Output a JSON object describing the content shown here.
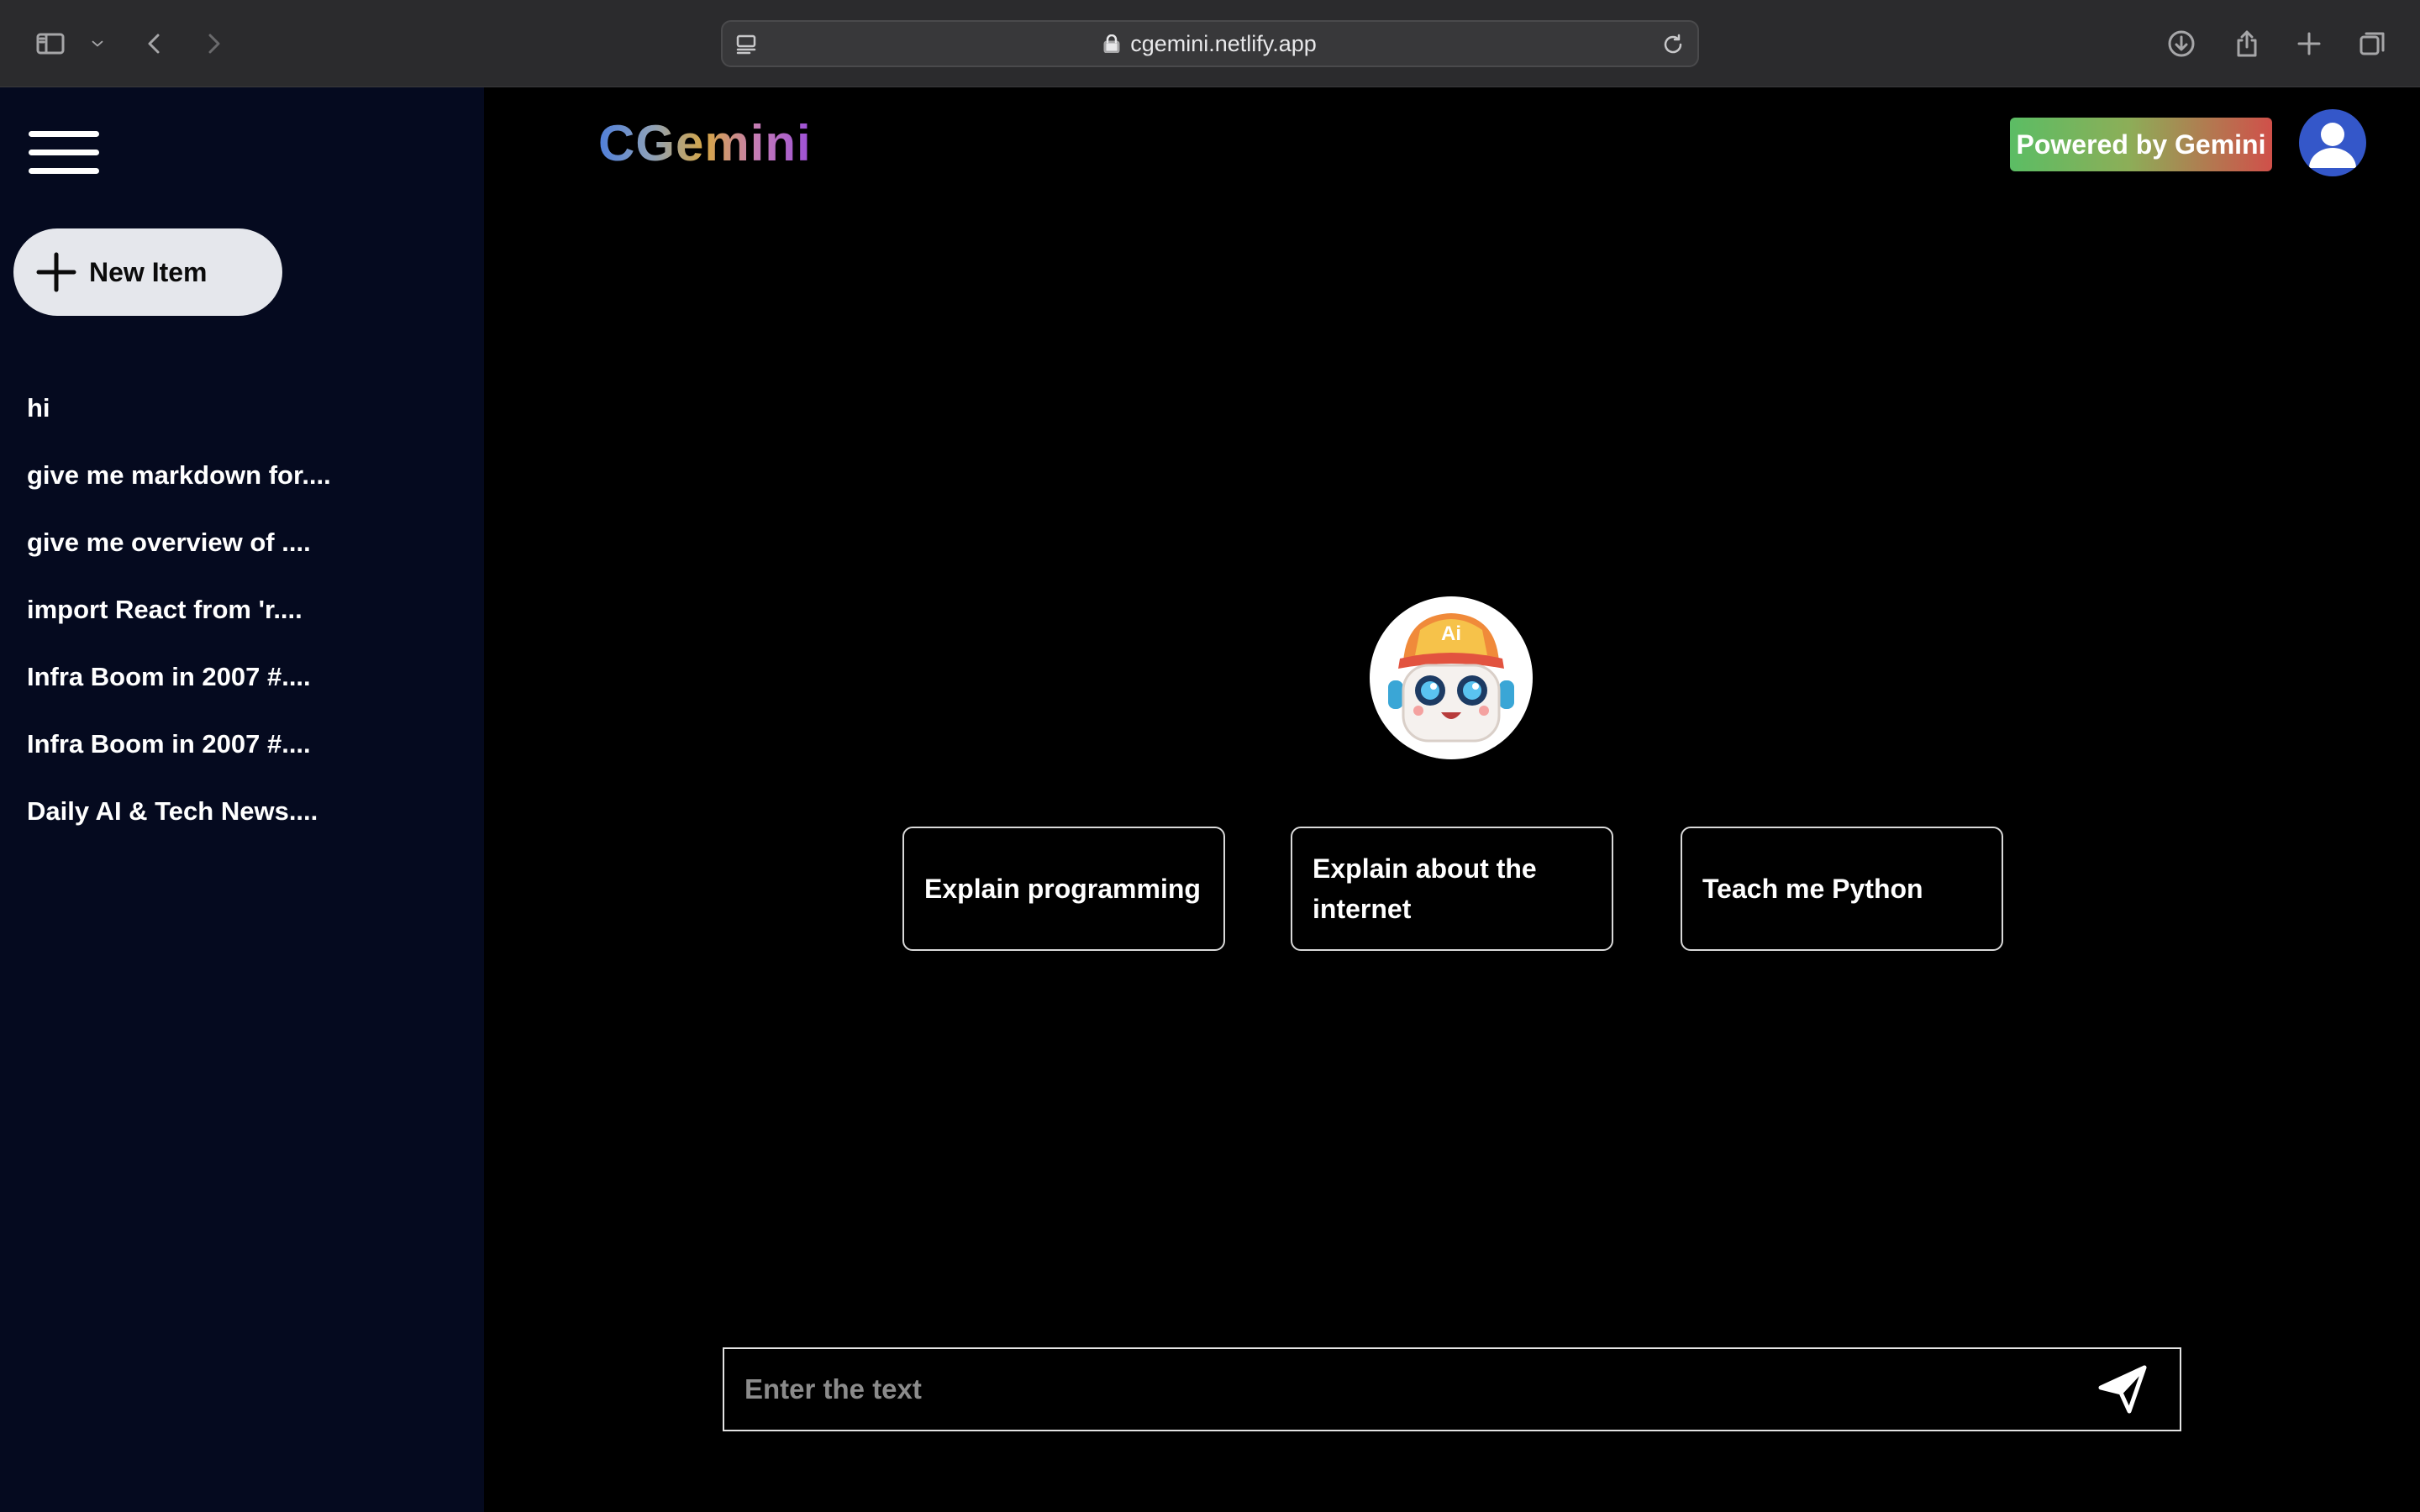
{
  "browser": {
    "url": "cgemini.netlify.app"
  },
  "sidebar": {
    "new_item_label": "New Item",
    "history": [
      {
        "label": "hi"
      },
      {
        "label": "give me markdown for...."
      },
      {
        "label": "give me overview of ...."
      },
      {
        "label": "import React from 'r...."
      },
      {
        "label": "Infra Boom in 2007 #...."
      },
      {
        "label": "Infra Boom in 2007 #...."
      },
      {
        "label": "Daily AI & Tech News...."
      }
    ]
  },
  "header": {
    "logo": "CGemini",
    "powered_badge": "Powered by Gemini"
  },
  "bot": {
    "cap_text": "Ai"
  },
  "suggestions": [
    {
      "label": "Explain programming"
    },
    {
      "label": "Explain about the internet"
    },
    {
      "label": "Teach me Python"
    }
  ],
  "composer": {
    "placeholder": "Enter the text",
    "value": ""
  },
  "colors": {
    "sidebar_bg": "#050a1f",
    "main_bg": "#000000",
    "avatar_bg": "#3457c9"
  },
  "icons": [
    "sidebar-toggle-icon",
    "chevron-down-icon",
    "back-icon",
    "forward-icon",
    "reader-icon",
    "lock-icon",
    "reload-icon",
    "download-icon",
    "share-icon",
    "new-tab-icon",
    "tabs-overview-icon",
    "hamburger-menu-icon",
    "plus-icon",
    "user-avatar-icon",
    "robot-mascot-icon",
    "send-icon"
  ]
}
